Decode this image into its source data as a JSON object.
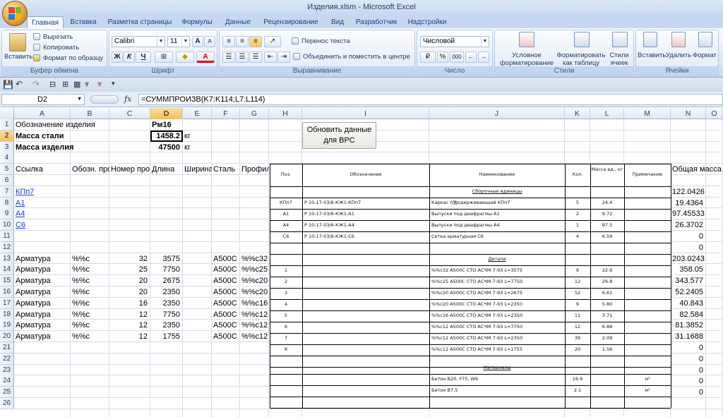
{
  "window": {
    "title": "Изделия.xlsm - Microsoft Excel"
  },
  "tabs": [
    "Главная",
    "Вставка",
    "Разметка страницы",
    "Формулы",
    "Данные",
    "Рецензирование",
    "Вид",
    "Разработчик",
    "Надстройки"
  ],
  "ribbon": {
    "clipboard": {
      "paste": "Вставить",
      "cut": "Вырезать",
      "copy": "Копировать",
      "format_painter": "Формат по образцу",
      "label": "Буфер обмена"
    },
    "font": {
      "name": "Calibri",
      "size": "11",
      "bold": "Ж",
      "italic": "К",
      "underline": "Ч",
      "label": "Шрифт",
      "grow": "A",
      "shrink": "A",
      "color_letter": "A"
    },
    "alignment": {
      "wrap": "Перенос текста",
      "merge": "Объединить и поместить в центре",
      "label": "Выравнивание"
    },
    "number": {
      "format": "Числовой",
      "percent": "%",
      "thousands": "000",
      "label": "Число"
    },
    "styles": {
      "conditional": "Условное форматирование",
      "as_table": "Форматировать как таблицу",
      "cell_styles": "Стили ячеек",
      "label": "Стили"
    },
    "cells": {
      "insert": "Вставить",
      "delete": "Удалить",
      "format": "Формат",
      "label": "Ячейки"
    }
  },
  "formula_bar": {
    "name_box": "D2",
    "fx": "fx",
    "formula": "=СУММПРОИЗВ(K7:K114;L7:L114)"
  },
  "columns": [
    "A",
    "B",
    "C",
    "D",
    "E",
    "F",
    "G",
    "H",
    "I",
    "J",
    "K",
    "L",
    "M",
    "N",
    "O"
  ],
  "rows": [
    "1",
    "2",
    "3",
    "4",
    "5",
    "6",
    "7",
    "8",
    "9",
    "10",
    "11",
    "12",
    "13",
    "14",
    "15",
    "16",
    "17",
    "18",
    "19",
    "20",
    "21",
    "22",
    "23",
    "24",
    "25",
    "26"
  ],
  "sheet": {
    "r1": {
      "A": "Обозначение изделия",
      "D": "Рм16"
    },
    "r2": {
      "A": "Масса стали",
      "D": "1458.2",
      "E": "кг"
    },
    "r3": {
      "A": "Масса изделия",
      "D": "47500",
      "E": "кг"
    },
    "r5": {
      "A": "Ссылка",
      "B": "Обозн. про",
      "C": "Номер про",
      "D": "Длина",
      "E": "Ширина",
      "F": "Сталь",
      "G": "Профил",
      "N": "Общая масса"
    },
    "links": [
      "КПп7",
      "А1",
      "А4",
      "С6"
    ],
    "armature": [
      {
        "A": "Арматура",
        "B": "%%c",
        "C": "32",
        "D": "3575",
        "F": "А500С",
        "G": "%%c32"
      },
      {
        "A": "Арматура",
        "B": "%%c",
        "C": "25",
        "D": "7750",
        "F": "А500С",
        "G": "%%c25"
      },
      {
        "A": "Арматура",
        "B": "%%c",
        "C": "20",
        "D": "2675",
        "F": "А500С",
        "G": "%%c20"
      },
      {
        "A": "Арматура",
        "B": "%%c",
        "C": "20",
        "D": "2350",
        "F": "А500С",
        "G": "%%c20"
      },
      {
        "A": "Арматура",
        "B": "%%c",
        "C": "16",
        "D": "2350",
        "F": "А500С",
        "G": "%%c16"
      },
      {
        "A": "Арматура",
        "B": "%%c",
        "C": "12",
        "D": "7750",
        "F": "А500С",
        "G": "%%c12"
      },
      {
        "A": "Арматура",
        "B": "%%c",
        "C": "12",
        "D": "2350",
        "F": "А500С",
        "G": "%%c12"
      },
      {
        "A": "Арматура",
        "B": "%%c",
        "C": "12",
        "D": "1755",
        "F": "А500С",
        "G": "%%c12"
      }
    ],
    "N": [
      "122.0426",
      "19.4364",
      "97.45533",
      "26.3702",
      "0",
      "0",
      "203.0243",
      "358.05",
      "343.577",
      "52.2405",
      "40.843",
      "82.584",
      "81.3852",
      "31.1688",
      "0",
      "0",
      "0",
      "0",
      "0"
    ]
  },
  "button": {
    "label": "Обновить данные для ВРС"
  },
  "spec": {
    "headers": {
      "pos": "Поз.",
      "designation": "Обозначение",
      "name": "Наименование",
      "qty": "Кол.",
      "mass": "Масса ед., кг",
      "note": "Примечание"
    },
    "section_assembly": "Сборочные единицы",
    "section_details": "Детали",
    "section_materials": "Материалы",
    "assembly": [
      {
        "pos": "КПп7",
        "des": "Р 10-17-03/6-КЖ1-КПп7",
        "name": "Каркас п独одерживающий КПп7",
        "qty": "5",
        "mass": "24.4"
      },
      {
        "pos": "А1",
        "des": "Р 10-17-03/6-КЖ1-А1",
        "name": "Выпуски под диафрагмы А1",
        "qty": "2",
        "mass": "9.72"
      },
      {
        "pos": "А4",
        "des": "Р 10-17-03/6-КЖ1-А4",
        "name": "Выпуски под диафрагмы А4",
        "qty": "1",
        "mass": "97.5"
      },
      {
        "pos": "С6",
        "des": "Р 10-17-03/6-КЖ1-С6",
        "name": "Сетка арматурная С6",
        "qty": "4",
        "mass": "6.59"
      }
    ],
    "details": [
      {
        "pos": "1",
        "name": "%%c32 А500С СТО АСЧМ 7-93 L=3575",
        "qty": "9",
        "mass": "22.6"
      },
      {
        "pos": "2",
        "name": "%%c25 А500С СТО АСЧМ 7-93 L=7750",
        "qty": "12",
        "mass": "29.8"
      },
      {
        "pos": "3",
        "name": "%%c20 А500С СТО АСЧМ 7-93 L=2675",
        "qty": "52",
        "mass": "6.61"
      },
      {
        "pos": "4",
        "name": "%%c20 А500С СТО АСЧМ 7-93 L=2350",
        "qty": "9",
        "mass": "5.80"
      },
      {
        "pos": "5",
        "name": "%%c16 А500С СТО АСЧМ 7-93 L=2350",
        "qty": "11",
        "mass": "3.71"
      },
      {
        "pos": "6",
        "name": "%%c12 А500С СТО АСЧМ 7-93 L=7750",
        "qty": "12",
        "mass": "6.88"
      },
      {
        "pos": "7",
        "name": "%%c12 А500С СТО АСЧМ 7-93 L=2350",
        "qty": "39",
        "mass": "2.09"
      },
      {
        "pos": "8",
        "name": "%%c12 А500С СТО АСЧМ 7-93 L=1755",
        "qty": "20",
        "mass": "1.56"
      }
    ],
    "materials": [
      {
        "name": "Бетон В20, F75, W6",
        "qty": "16.9",
        "note": "м³"
      },
      {
        "name": "Бетон В7,5",
        "qty": "2.1",
        "note": "м³"
      }
    ]
  }
}
